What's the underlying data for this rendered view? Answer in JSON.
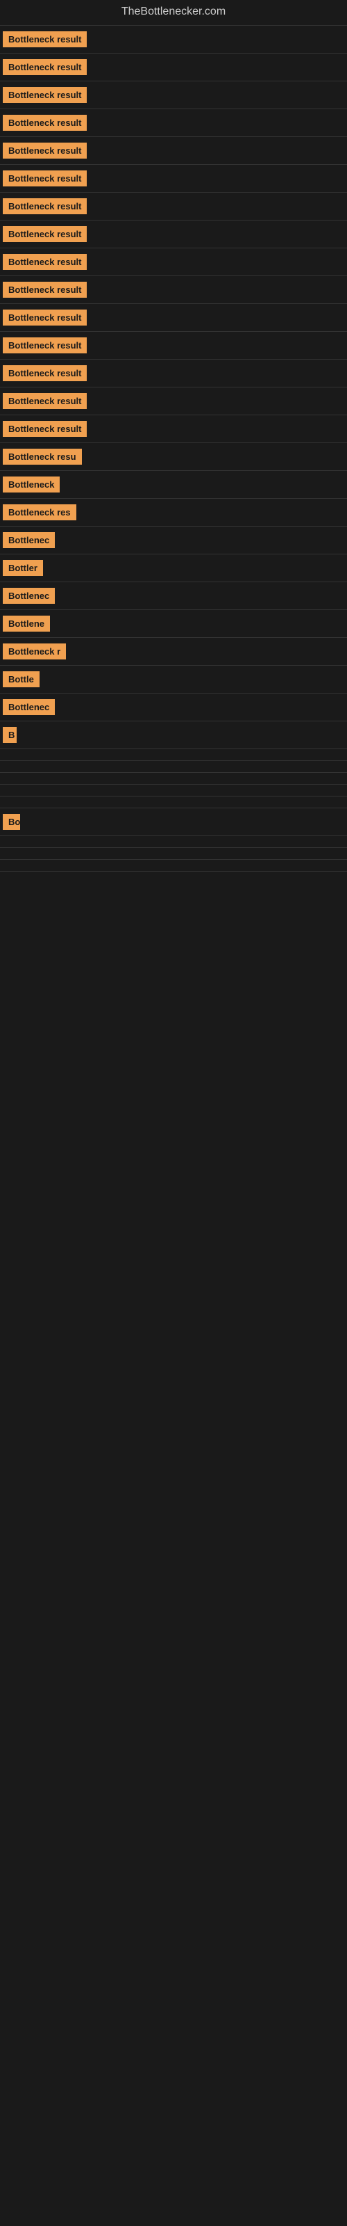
{
  "site": {
    "title": "TheBottlenecker.com"
  },
  "items": [
    {
      "label": "Bottleneck result",
      "visible_width": 160
    },
    {
      "label": "Bottleneck result",
      "visible_width": 160
    },
    {
      "label": "Bottleneck result",
      "visible_width": 160
    },
    {
      "label": "Bottleneck result",
      "visible_width": 160
    },
    {
      "label": "Bottleneck result",
      "visible_width": 160
    },
    {
      "label": "Bottleneck result",
      "visible_width": 160
    },
    {
      "label": "Bottleneck result",
      "visible_width": 160
    },
    {
      "label": "Bottleneck result",
      "visible_width": 160
    },
    {
      "label": "Bottleneck result",
      "visible_width": 160
    },
    {
      "label": "Bottleneck result",
      "visible_width": 160
    },
    {
      "label": "Bottleneck result",
      "visible_width": 160
    },
    {
      "label": "Bottleneck result",
      "visible_width": 160
    },
    {
      "label": "Bottleneck result",
      "visible_width": 160
    },
    {
      "label": "Bottleneck result",
      "visible_width": 160
    },
    {
      "label": "Bottleneck result",
      "visible_width": 160
    },
    {
      "label": "Bottleneck resu",
      "visible_width": 140
    },
    {
      "label": "Bottleneck",
      "visible_width": 90
    },
    {
      "label": "Bottleneck res",
      "visible_width": 120
    },
    {
      "label": "Bottlenec",
      "visible_width": 80
    },
    {
      "label": "Bottler",
      "visible_width": 60
    },
    {
      "label": "Bottlenec",
      "visible_width": 80
    },
    {
      "label": "Bottlene",
      "visible_width": 72
    },
    {
      "label": "Bottleneck r",
      "visible_width": 100
    },
    {
      "label": "Bottle",
      "visible_width": 55
    },
    {
      "label": "Bottlenec",
      "visible_width": 80
    },
    {
      "label": "B",
      "visible_width": 20
    },
    {
      "label": "",
      "visible_width": 0
    },
    {
      "label": "",
      "visible_width": 0
    },
    {
      "label": "",
      "visible_width": 0
    },
    {
      "label": "",
      "visible_width": 0
    },
    {
      "label": "",
      "visible_width": 0
    },
    {
      "label": "Bo",
      "visible_width": 25
    },
    {
      "label": "",
      "visible_width": 0
    },
    {
      "label": "",
      "visible_width": 0
    },
    {
      "label": "",
      "visible_width": 0
    },
    {
      "label": "",
      "visible_width": 0
    }
  ]
}
